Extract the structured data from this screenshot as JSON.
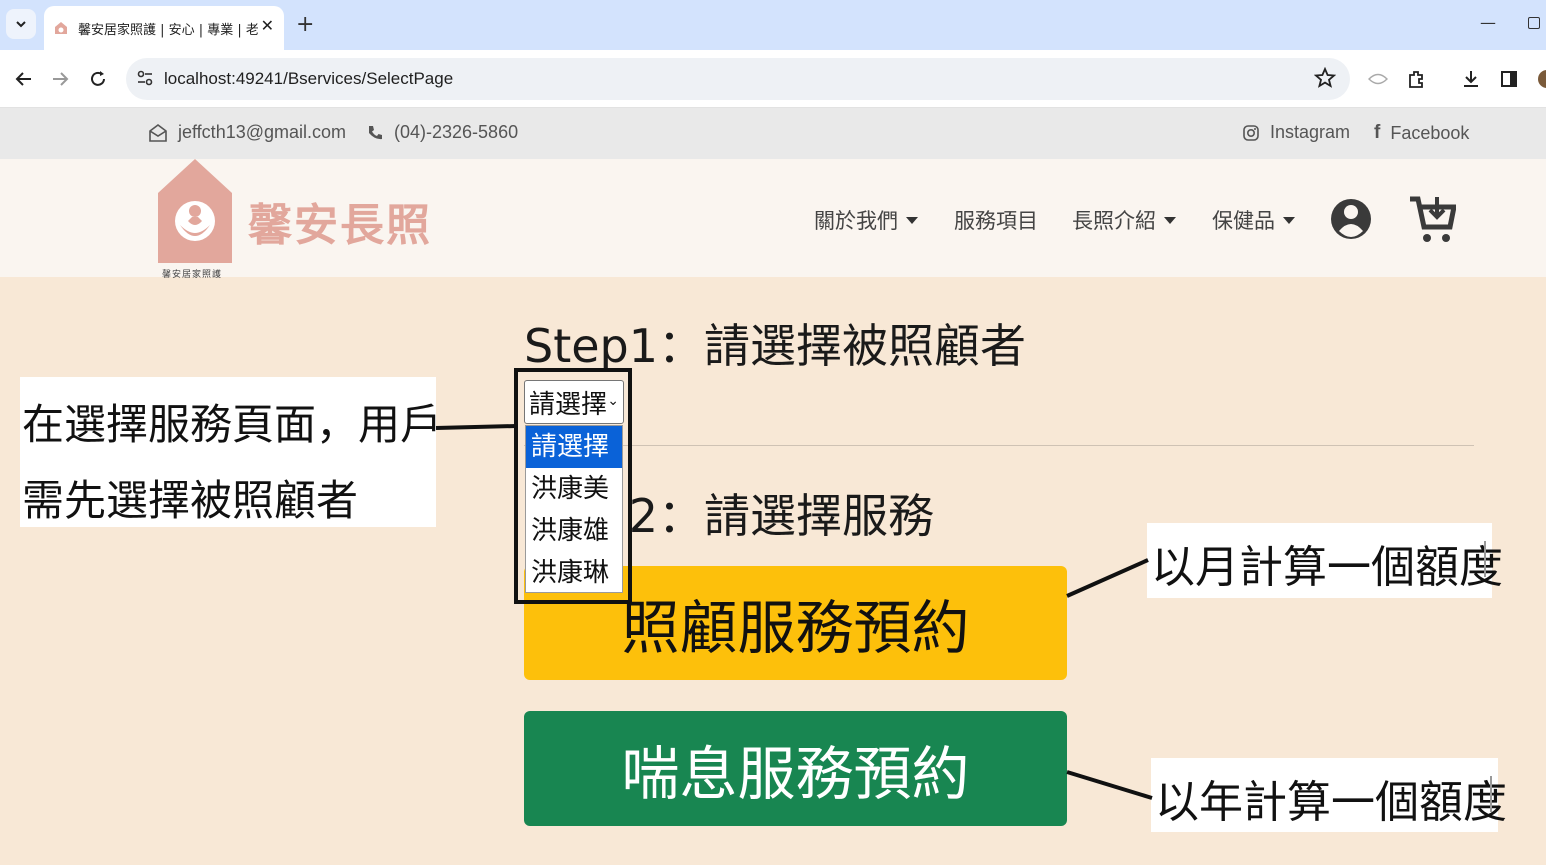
{
  "browser": {
    "tab_title": "馨安居家照護 | 安心 | 專業 | 老人",
    "url": "localhost:49241/Bservices/SelectPage"
  },
  "topbar": {
    "email": "jeffcth13@gmail.com",
    "phone": "(04)-2326-5860",
    "instagram": "Instagram",
    "facebook": "Facebook"
  },
  "header": {
    "logo_text": "馨安長照",
    "logo_caption": "馨安居家照護",
    "nav": [
      "關於我們",
      "服務項目",
      "長照介紹",
      "保健品"
    ]
  },
  "main": {
    "step1": "Step1：請選擇被照顧者",
    "step2_suffix": "2：請選擇服務",
    "select_value": "請選擇",
    "options": [
      "請選擇",
      "洪康美",
      "洪康雄",
      "洪康琳"
    ],
    "care_button": "照顧服務預約",
    "respite_button": "喘息服務預約"
  },
  "annotations": {
    "left_line1": "在選擇服務頁面，用戶",
    "left_line2": "需先選擇被照顧者",
    "right1": "以月計算一個額度",
    "right2": "以年計算一個額度"
  },
  "colors": {
    "page_bg": "#f8e8d6",
    "care_button": "#fdc00b",
    "respite_button": "#188651",
    "logo": "#e2a79c",
    "selected_option": "#0a62d8"
  },
  "icons": [
    "chevron-down-icon",
    "favicon-icon",
    "close-icon",
    "plus-icon",
    "back-icon",
    "forward-icon",
    "reload-icon",
    "site-settings-icon",
    "star-icon",
    "extensions-icon",
    "download-icon",
    "sidepanel-icon",
    "mail-icon",
    "phone-icon",
    "instagram-icon",
    "facebook-icon",
    "user-icon",
    "cart-icon"
  ]
}
